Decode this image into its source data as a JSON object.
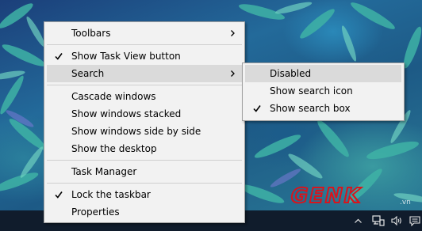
{
  "context_menu": {
    "items": [
      {
        "label": "Toolbars",
        "checked": false,
        "has_submenu": true
      },
      {
        "label": "Show Task View button",
        "checked": true,
        "has_submenu": false
      },
      {
        "label": "Search",
        "checked": false,
        "has_submenu": true,
        "highlighted": true
      },
      {
        "label": "Cascade windows",
        "checked": false,
        "has_submenu": false
      },
      {
        "label": "Show windows stacked",
        "checked": false,
        "has_submenu": false
      },
      {
        "label": "Show windows side by side",
        "checked": false,
        "has_submenu": false
      },
      {
        "label": "Show the desktop",
        "checked": false,
        "has_submenu": false
      },
      {
        "label": "Task Manager",
        "checked": false,
        "has_submenu": false
      },
      {
        "label": "Lock the taskbar",
        "checked": true,
        "has_submenu": false
      },
      {
        "label": "Properties",
        "checked": false,
        "has_submenu": false
      }
    ]
  },
  "search_submenu": {
    "items": [
      {
        "label": "Disabled",
        "checked": false,
        "highlighted": true
      },
      {
        "label": "Show search icon",
        "checked": false
      },
      {
        "label": "Show search box",
        "checked": true
      }
    ]
  },
  "tray_icons": [
    "chevron-up-icon",
    "network-icon",
    "volume-icon",
    "notifications-icon"
  ],
  "watermark": {
    "text": "GENK",
    "suffix": ".vn"
  },
  "colors": {
    "menu_bg": "#f2f2f2",
    "menu_highlight": "#dadada",
    "menu_border": "#a0a0a0",
    "taskbar_bg": "#101c2c",
    "watermark_red": "#d9141c"
  }
}
